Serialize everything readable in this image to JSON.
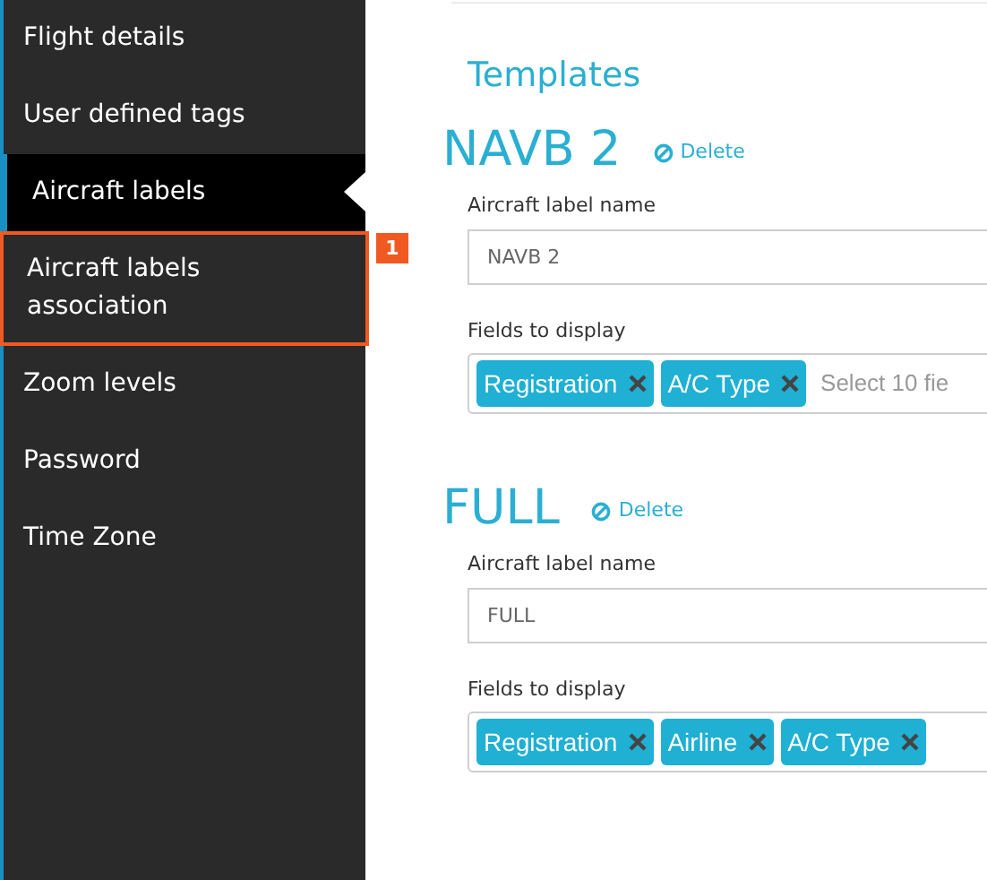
{
  "sidebar": {
    "items": [
      {
        "label": "Flight details",
        "selected": false,
        "highlighted": false
      },
      {
        "label": "User defined tags",
        "selected": false,
        "highlighted": false
      },
      {
        "label": "Aircraft labels",
        "selected": true,
        "highlighted": false
      },
      {
        "label": "Aircraft labels association",
        "selected": false,
        "highlighted": true
      },
      {
        "label": "Zoom levels",
        "selected": false,
        "highlighted": false
      },
      {
        "label": "Password",
        "selected": false,
        "highlighted": false
      },
      {
        "label": "Time Zone",
        "selected": false,
        "highlighted": false
      }
    ]
  },
  "annotation_badge": "1",
  "heading": "Templates",
  "templates": [
    {
      "title": "NAVB 2",
      "delete": "Delete",
      "name_label": "Aircraft label name",
      "name_value": "NAVB 2",
      "fields_label": "Fields to display",
      "fields": [
        "Registration",
        "A/C Type"
      ],
      "placeholder": "Select 10 fie"
    },
    {
      "title": "FULL",
      "delete": "Delete",
      "name_label": "Aircraft label name",
      "name_value": "FULL",
      "fields_label": "Fields to display",
      "fields": [
        "Registration",
        "Airline",
        "A/C Type"
      ]
    }
  ]
}
